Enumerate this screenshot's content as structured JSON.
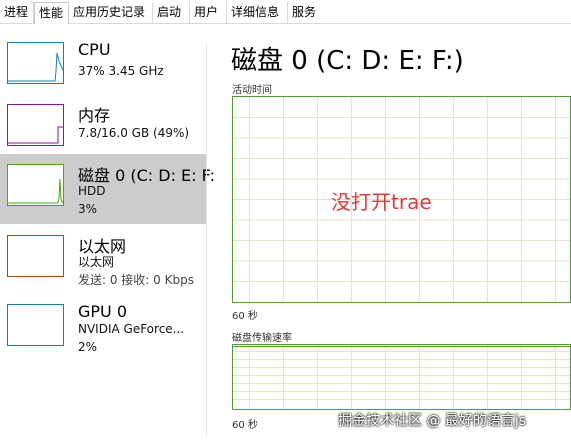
{
  "tabs": [
    "进程",
    "性能",
    "应用历史记录",
    "启动",
    "用户",
    "详细信息",
    "服务"
  ],
  "sidebar": {
    "items": [
      {
        "name": "CPU",
        "line1": "37% 3.45 GHz",
        "line2": ""
      },
      {
        "name": "内存",
        "line1": "7.8/16.0 GB (49%)",
        "line2": ""
      },
      {
        "name": "磁盘 0 (C: D: E: F:",
        "line1": "HDD",
        "line2": "3%"
      },
      {
        "name": "以太网",
        "line1": "以太网",
        "line2": "发送: 0 接收: 0 Kbps"
      },
      {
        "name": "GPU 0",
        "line1": "NVIDIA GeForce...",
        "line2": "2%"
      }
    ]
  },
  "main": {
    "title": "磁盘 0 (C: D: E: F:)",
    "active_time_label": "活动时间",
    "active_time_span": "60 秒",
    "transfer_label": "磁盘传输速率",
    "transfer_span": "60 秒"
  },
  "annotation": "没打开trae",
  "watermark": "掘金技术社区 @ 最好的语言js",
  "colors": {
    "cpu": "#117dbb",
    "memory": "#8b12ae",
    "disk": "#4da60c",
    "ethernet": "#a74f01",
    "gpu": "#117dbb",
    "selected": "#cccccc",
    "annotation": "#e03a3a"
  },
  "active_tab_index": 1
}
